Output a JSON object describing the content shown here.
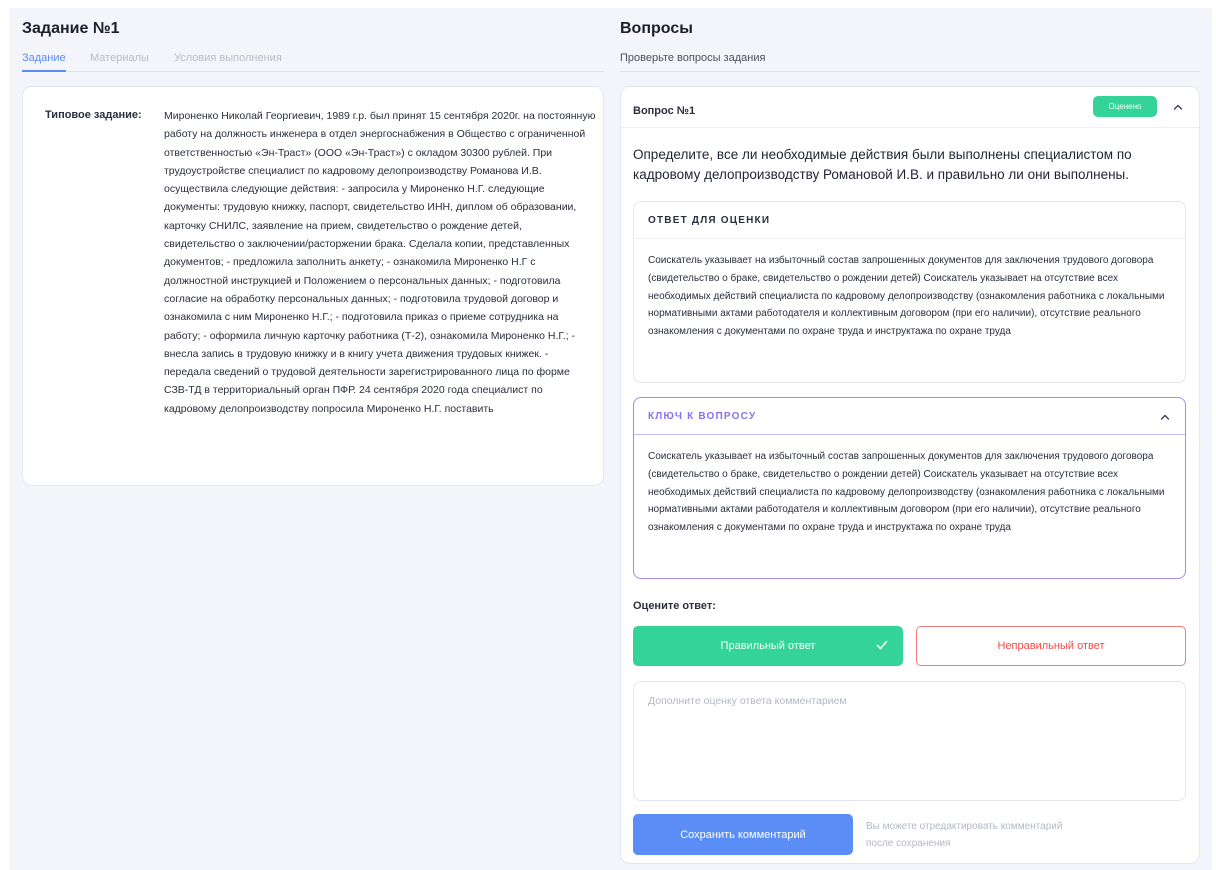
{
  "left": {
    "title": "Задание №1",
    "tabs": [
      {
        "label": "Задание",
        "active": true
      },
      {
        "label": "Материалы",
        "active": false
      },
      {
        "label": "Условия выполнения",
        "active": false
      }
    ],
    "task": {
      "label": "Типовое задание:",
      "text": "Мироненко Николай Георгиевич, 1989 г.р. был принят 15 сентября 2020г. на постоянную работу на должность инженера в отдел энергоснабжения в Общество с ограниченной ответственностью «Эн-Траст» (ООО «Эн-Траст») с окладом 30300 рублей. При трудоустройстве специалист по кадровому делопроизводству Романова И.В. осуществила следующие действия: - запросила у Мироненко Н.Г. следующие документы: трудовую книжку, паспорт, свидетельство ИНН, диплом об образовании, карточку СНИЛС, заявление на прием, свидетельство о рождение детей, свидетельство о заключении/расторжении брака. Сделала копии, представленных документов; - предложила заполнить анкету; - ознакомила Мироненко Н.Г с должностной инструкцией и Положением о персональных данных; - подготовила согласие на обработку персональных данных; - подготовила трудовой договор и ознакомила с ним Мироненко Н.Г.; - подготовила приказ о приеме сотрудника на работу; - оформила личную карточку работника (Т-2), ознакомила Мироненко Н.Г.; - внесла запись в трудовую книжку и в книгу учета движения трудовых книжек. - передала сведений о трудовой деятельности зарегистрированного лица по форме СЗВ-ТД в территориальный орган ПФР. 24 сентября 2020 года специалист по кадровому делопроизводству попросила Мироненко Н.Г. поставить"
    }
  },
  "right": {
    "title": "Вопросы",
    "subtitle": "Проверьте вопросы задания",
    "question": {
      "header": "Вопрос №1",
      "badge": "Оценено",
      "text": "Определите, все ли необходимые действия были выполнены специалистом по кадровому делопроизводству Романовой И.В. и правильно ли они выполнены.",
      "answer_title": "ОТВЕТ ДЛЯ ОЦЕНКИ",
      "answer_text": "Соискатель указывает на избыточный состав запрошенных документов для заключения трудового договора (свидетельство о браке, свидетельство о рождении детей) Соискатель указывает на отсутствие всех необходимых действий специалиста по кадровому делопроизводству (ознакомления работника с локальными нормативными актами работодателя и коллективным договором (при его наличии), отсутствие реального ознакомления с документами по охране труда и инструктажа по охране труда",
      "key_title": "КЛЮЧ К ВОПРОСУ",
      "key_text": "Соискатель указывает на избыточный состав запрошенных документов для заключения трудового договора (свидетельство о браке, свидетельство о рождении детей) Соискатель указывает на отсутствие всех необходимых действий специалиста по кадровому делопроизводству (ознакомления работника с локальными нормативными актами работодателя и коллективным договором (при его наличии), отсутствие реального ознакомления с документами по охране труда и инструктажа по охране труда",
      "rate_label": "Оцените ответ:",
      "correct_label": "Правильный ответ",
      "incorrect_label": "Неправильный ответ",
      "comment_value": "",
      "comment_placeholder": "Дополните оценку ответа комментарием",
      "save_label": "Сохранить комментарий",
      "save_hint": "Вы можете отредактировать комментарий после сохранения"
    }
  },
  "colors": {
    "accent_blue": "#5b8df6",
    "success_green": "#34d399",
    "error_red": "#ef4b4b",
    "key_purple": "#8b6ff2"
  },
  "icons": [
    "chevron-up-icon",
    "checkmark-icon"
  ]
}
